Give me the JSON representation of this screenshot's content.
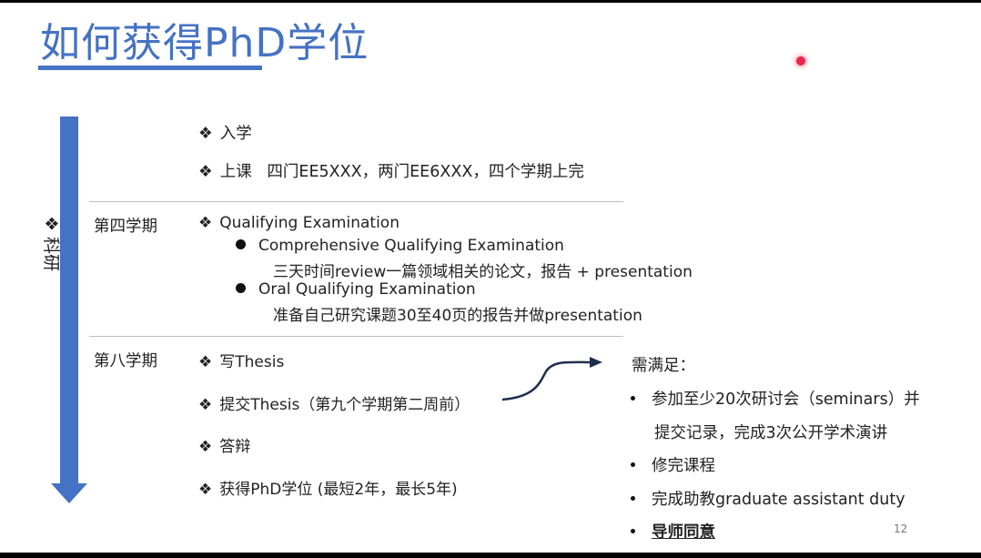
{
  "slide": {
    "title": "如何获得PhD学位",
    "timeline_label": "❖ 科研",
    "page_number": "12"
  },
  "rows": {
    "r1": {
      "bullet": "❖",
      "text": "入学"
    },
    "r2": {
      "bullet": "❖",
      "text": "上课   四门EE5XXX，两门EE6XXX，四个学期上完"
    },
    "sem4": "第四学期",
    "qe": {
      "bullet": "❖",
      "text": "Qualifying Examination"
    },
    "cqe": {
      "text": "Comprehensive Qualifying Examination",
      "detail": "三天时间review一篇领域相关的论文，报告 + presentation"
    },
    "oqe": {
      "text": "Oral Qualifying Examination",
      "detail": "准备自己研究课题30至40页的报告并做presentation"
    },
    "sem8": "第八学期",
    "thesis_write": {
      "bullet": "❖",
      "text": "写Thesis"
    },
    "thesis_submit": {
      "bullet": "❖",
      "text": "提交Thesis（第九个学期第二周前）"
    },
    "defense": {
      "bullet": "❖",
      "text": "答辩"
    },
    "degree": {
      "bullet": "❖",
      "text": "获得PhD学位 (最短2年，最长5年)"
    }
  },
  "requirements": {
    "heading": "需满足：",
    "items": [
      "参加至少20次研讨会（seminars）并",
      "提交记录，完成3次公开学术演讲",
      "修完课程",
      "完成助教graduate assistant duty",
      "导师同意"
    ]
  },
  "colors": {
    "accent": "#4472c4",
    "arrow": "#1f2d4f",
    "pointer": "#e8264a"
  }
}
